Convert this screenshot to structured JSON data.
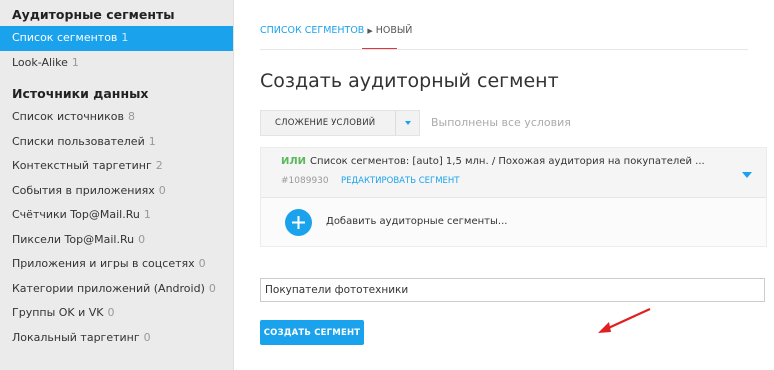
{
  "sidebar": {
    "section1_title": "Аудиторные сегменты",
    "section1_items": [
      {
        "label": "Список сегментов",
        "count": "1",
        "active": true
      },
      {
        "label": "Look-Alike",
        "count": "1"
      }
    ],
    "section2_title": "Источники данных",
    "section2_items": [
      {
        "label": "Список источников",
        "count": "8"
      },
      {
        "label": "Списки пользователей",
        "count": "1"
      },
      {
        "label": "Контекстный таргетинг",
        "count": "2"
      },
      {
        "label": "События в приложениях",
        "count": "0"
      },
      {
        "label": "Счётчики Top@Mail.Ru",
        "count": "1"
      },
      {
        "label": "Пиксели Top@Mail.Ru",
        "count": "0"
      },
      {
        "label": "Приложения и игры в соцсетях",
        "count": "0"
      },
      {
        "label": "Категории приложений (Android)",
        "count": "0"
      },
      {
        "label": "Группы OK и VK",
        "count": "0"
      },
      {
        "label": "Локальный таргетинг",
        "count": "0"
      }
    ]
  },
  "breadcrumb": {
    "parent": "СПИСОК СЕГМЕНТОВ",
    "current": "НОВЫЙ"
  },
  "page_title": "Создать аудиторный сегмент",
  "condition_select": {
    "value": "СЛОЖЕНИЕ УСЛОВИЙ",
    "hint": "Выполнены все условия"
  },
  "segment": {
    "operator": "ИЛИ",
    "description": "Список сегментов: [auto] 1,5 млн. / Похожая аудитория на покупателей ...",
    "id": "#1089930",
    "edit_label": "РЕДАКТИРОВАТЬ СЕГМЕНТ"
  },
  "add_segments_label": "Добавить аудиторные сегменты...",
  "name_input": {
    "value": "Покупатели фототехники"
  },
  "create_button_label": "СОЗДАТЬ СЕГМЕНТ",
  "colors": {
    "accent": "#1aa3ec",
    "or_green": "#5cb85c",
    "annotation_red": "#e02020",
    "tab_underline": "#e6343f"
  }
}
